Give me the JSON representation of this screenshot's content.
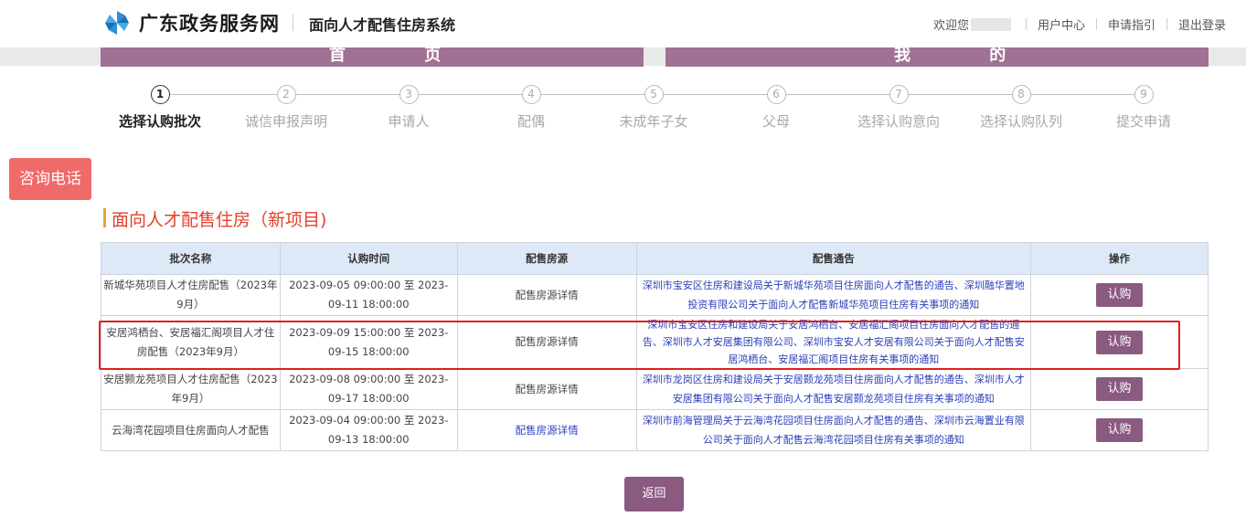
{
  "header": {
    "site_name": "广东政务服务网",
    "system_name": "面向人才配售住房系统",
    "welcome": "欢迎您",
    "links": [
      "用户中心",
      "申请指引",
      "退出登录"
    ]
  },
  "nav": {
    "home": "首 页",
    "mine": "我 的"
  },
  "steps": [
    {
      "num": "1",
      "label": "选择认购批次",
      "active": true
    },
    {
      "num": "2",
      "label": "诚信申报声明",
      "active": false
    },
    {
      "num": "3",
      "label": "申请人",
      "active": false
    },
    {
      "num": "4",
      "label": "配偶",
      "active": false
    },
    {
      "num": "5",
      "label": "未成年子女",
      "active": false
    },
    {
      "num": "6",
      "label": "父母",
      "active": false
    },
    {
      "num": "7",
      "label": "选择认购意向",
      "active": false
    },
    {
      "num": "8",
      "label": "选择认购队列",
      "active": false
    },
    {
      "num": "9",
      "label": "提交申请",
      "active": false
    }
  ],
  "hotline": "咨询电话",
  "section_title": "面向人才配售住房（新项目)",
  "table": {
    "headers": [
      "批次名称",
      "认购时间",
      "配售房源",
      "配售通告",
      "操作"
    ],
    "rows": [
      {
        "name": "新城华苑项目人才住房配售（2023年9月）",
        "time": "2023-09-05 09:00:00 至 2023-09-11 18:00:00",
        "source": "配售房源详情",
        "notice": "深圳市宝安区住房和建设局关于新城华苑项目住房面向人才配售的通告、深圳融华置地投资有限公司关于面向人才配售新城华苑项目住房有关事项的通知",
        "action": "认购"
      },
      {
        "name": "安居鸿栖台、安居福汇阁项目人才住房配售（2023年9月）",
        "time": "2023-09-09 15:00:00 至 2023-09-15 18:00:00",
        "source": "配售房源详情",
        "notice": "深圳市宝安区住房和建设局关于安居鸿栖台、安居福汇阁项目住房面向人才配售的通告、深圳市人才安居集团有限公司、深圳市宝安人才安居有限公司关于面向人才配售安居鸿栖台、安居福汇阁项目住房有关事项的通知",
        "action": "认购"
      },
      {
        "name": "安居颢龙苑项目人才住房配售（2023年9月）",
        "time": "2023-09-08 09:00:00 至 2023-09-17 18:00:00",
        "source": "配售房源详情",
        "notice": "深圳市龙岗区住房和建设局关于安居颢龙苑项目住房面向人才配售的通告、深圳市人才安居集团有限公司关于面向人才配售安居颢龙苑项目住房有关事项的通知",
        "action": "认购"
      },
      {
        "name": "云海湾花园项目住房面向人才配售",
        "time": "2023-09-04 09:00:00 至 2023-09-13 18:00:00",
        "source": "配售房源详情",
        "notice": "深圳市前海管理局关于云海湾花园项目住房面向人才配售的通告、深圳市云海置业有限公司关于面向人才配售云海湾花园项目住房有关事项的通知",
        "action": "认购"
      }
    ]
  },
  "back_button": "返回",
  "colors": {
    "accent": "#8a5a80",
    "nav": "#a07193",
    "title": "#e2412c",
    "hotline": "#f06a6a",
    "link": "#2a3fb8"
  }
}
